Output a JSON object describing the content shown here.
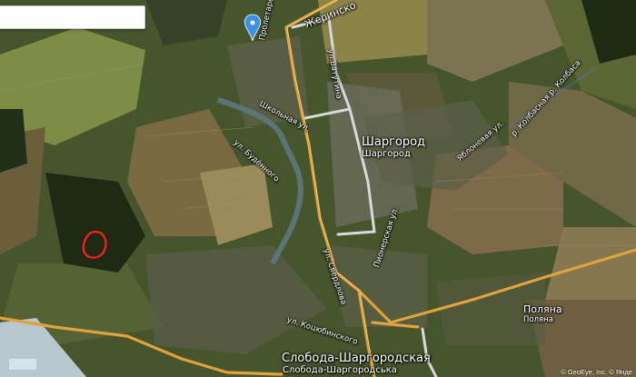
{
  "search": {
    "value": "",
    "placeholder": ""
  },
  "places": {
    "city_main": "Шаргород",
    "city_main_sub": "Шаргород",
    "sloboda": "Слобода-Шаргородская",
    "sloboda_sub": "Слобода-Шаргородська",
    "polyana": "Поляна",
    "polyana_sub": "Поляна"
  },
  "streets": {
    "zhmerinskaya": "Жеринско",
    "vatutina": "ул.Ватутина",
    "proletarskaya": "Пролетарская ул.",
    "shkolnaya": "Школьная ул.",
    "budennogo": "ул. Будённого",
    "pionerskaya": "Пионерская ул.",
    "sverdlova": "ул. Свердлова",
    "kotsyubinskogo": "ул. Коцюбинского",
    "yablonevaya": "Яблоневая ул.",
    "kolbasnaya": "р. Колбасная р. Колбаса"
  },
  "attribution": "© GeoEye, Inc. © Янде",
  "colors": {
    "road": "#e3a43a",
    "highlight_road": "#d6d6d6",
    "river": "#6e8ca0",
    "marker": "#ff1a1a",
    "pin": "#3b8fe8",
    "field_light": "#7a8b44",
    "field_dark": "#2f3d1f"
  },
  "icons": {
    "pin": "map-pin-icon",
    "marker": "highlight-outline"
  }
}
